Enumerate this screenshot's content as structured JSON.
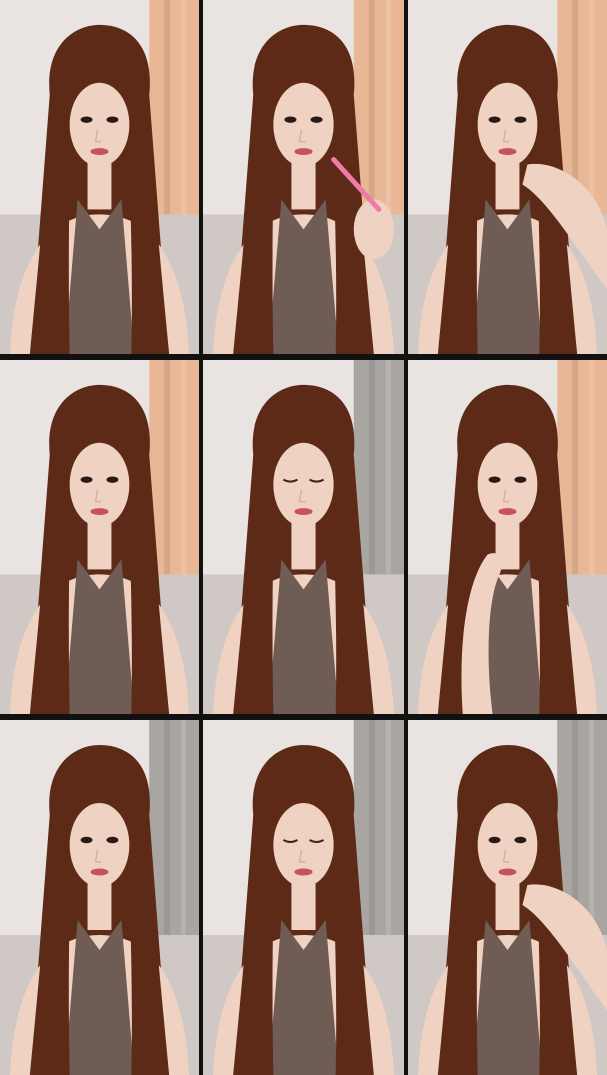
{
  "collage": {
    "rows": 3,
    "columns": 3,
    "background_color": "#111111",
    "tiles": [
      {
        "pose": "hair-down",
        "eyes": "open",
        "hand": "none",
        "curtain": "peach"
      },
      {
        "pose": "applying-lipstick",
        "eyes": "open",
        "hand": "right-with-pink-pen",
        "curtain": "peach"
      },
      {
        "pose": "chin-on-hand",
        "eyes": "open",
        "hand": "right-under-chin",
        "curtain": "peach"
      },
      {
        "pose": "hair-down",
        "eyes": "open",
        "hand": "none",
        "curtain": "peach"
      },
      {
        "pose": "head-tilted",
        "eyes": "closed",
        "hand": "none",
        "curtain": "grey"
      },
      {
        "pose": "hand-to-neck",
        "eyes": "open",
        "hand": "left-at-neck",
        "curtain": "peach"
      },
      {
        "pose": "hair-down",
        "eyes": "open",
        "hand": "none",
        "curtain": "grey"
      },
      {
        "pose": "eyes-closed",
        "eyes": "closed",
        "hand": "none",
        "curtain": "grey"
      },
      {
        "pose": "chin-on-hand",
        "eyes": "open",
        "hand": "right-under-chin",
        "curtain": "grey"
      }
    ]
  },
  "colors": {
    "wall": "#e9e4e1",
    "curtain_peach": "#e9b796",
    "curtain_grey": "#a9a6a2",
    "hair": "#5e2a18",
    "skin": "#f0d2c2",
    "top": "#6e5c55",
    "lips": "#c8525a",
    "pen": "#f07aa8"
  }
}
